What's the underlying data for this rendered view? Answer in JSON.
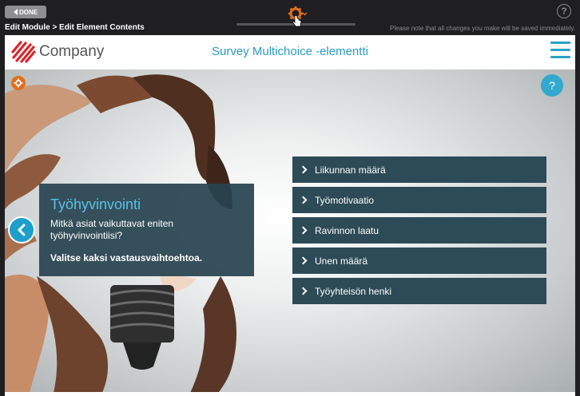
{
  "editor": {
    "done_label": "DONE",
    "breadcrumb": "Edit Module > Edit Element Contents",
    "save_note": "Please note that all changes you make will be saved immediately.",
    "help_glyph": "?",
    "icons": [
      "arrow-left-icon",
      "gear-icon",
      "chevron-down-icon",
      "help-icon"
    ],
    "accent_color": "#e26f1d"
  },
  "header": {
    "company": "Company",
    "title": "Survey Multichoice -elementti",
    "title_color": "#2b9cc0",
    "icons": [
      "logo-icon",
      "hamburger-icon"
    ]
  },
  "scene": {
    "help_glyph": "?",
    "info": {
      "title": "Työhyvinvointi",
      "question": "Mitkä asiat vaikuttavat eniten työhyvinvointiisi?",
      "instruction": "Valitse kaksi vastausvaihtoehtoa."
    },
    "options": [
      {
        "label": "Liikunnan määrä"
      },
      {
        "label": "Työmotivaatio"
      },
      {
        "label": "Ravinnon laatu"
      },
      {
        "label": "Unen määrä"
      },
      {
        "label": "Työyhteisön henki"
      }
    ],
    "option_color": "#2d4b57",
    "icons": [
      "gear-icon",
      "help-icon",
      "chevron-left-icon",
      "chevron-right-icon",
      "lightbulb-icon"
    ]
  }
}
